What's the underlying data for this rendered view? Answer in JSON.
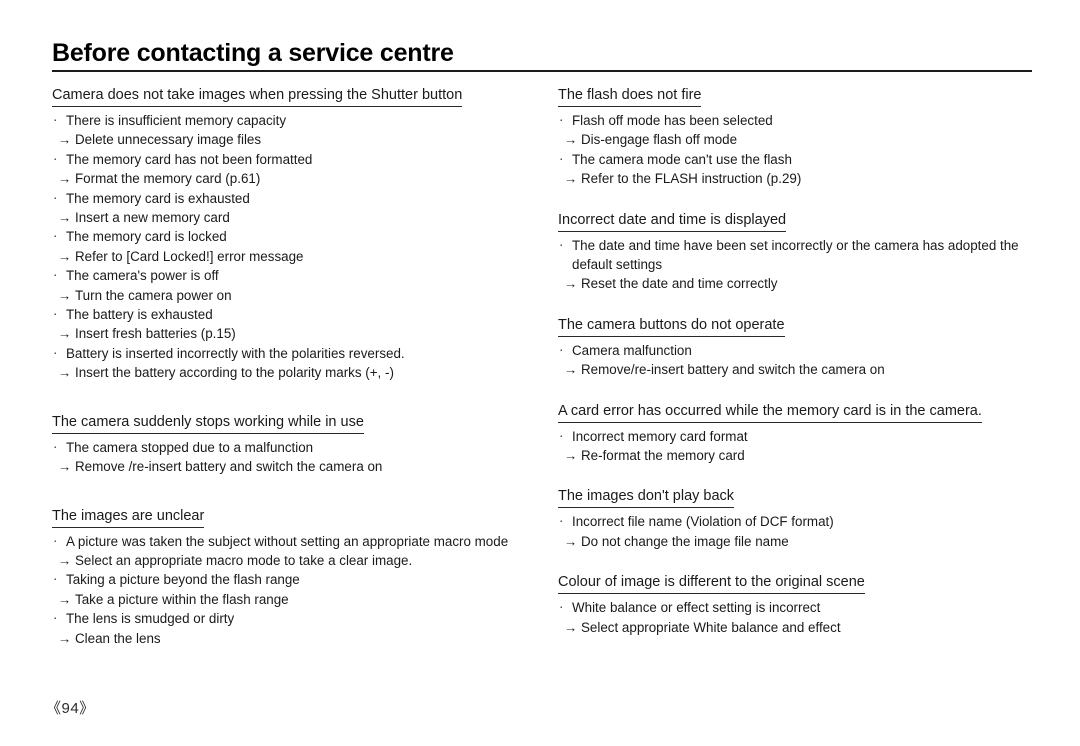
{
  "header": {
    "title": "Before contacting a service centre"
  },
  "footer": {
    "page_number": "《94》"
  },
  "glyphs": {
    "bullet": "·",
    "arrow": "→"
  },
  "columns": {
    "left": [
      {
        "heading": "Camera does not take images when pressing the Shutter button",
        "entries": [
          {
            "cause": "There is insufficient memory capacity",
            "remedy": "Delete unnecessary image files"
          },
          {
            "cause": "The memory card has not been formatted",
            "remedy": "Format the memory card (p.61)"
          },
          {
            "cause": "The memory card is exhausted",
            "remedy": "Insert a new memory card"
          },
          {
            "cause": "The memory card is locked",
            "remedy": "Refer to [Card Locked!] error message"
          },
          {
            "cause": "The camera's power is off",
            "remedy": "Turn the camera power on"
          },
          {
            "cause": "The battery is exhausted",
            "remedy": "Insert fresh batteries (p.15)"
          },
          {
            "cause": "Battery is inserted incorrectly with the polarities reversed.",
            "remedy": "Insert the battery according to the polarity marks (+, -)"
          }
        ]
      },
      {
        "heading": "The camera suddenly stops working while in use",
        "entries": [
          {
            "cause": "The camera stopped due to a malfunction",
            "remedy": "Remove /re-insert battery and switch the camera on"
          }
        ]
      },
      {
        "heading": "The images are unclear",
        "entries": [
          {
            "cause": "A picture was taken the subject without setting an appropriate macro mode",
            "remedy": "Select an appropriate macro mode to take a clear image."
          },
          {
            "cause": "Taking a picture beyond the flash range",
            "remedy": "Take a picture within the flash range"
          },
          {
            "cause": "The lens is smudged or dirty",
            "remedy": "Clean the lens"
          }
        ]
      }
    ],
    "right": [
      {
        "heading": "The flash does not fire",
        "entries": [
          {
            "cause": "Flash off mode has been selected",
            "remedy": "Dis-engage flash off mode"
          },
          {
            "cause": "The camera mode can't use the flash",
            "remedy": "Refer to the FLASH instruction (p.29)"
          }
        ]
      },
      {
        "heading": "Incorrect date and time is displayed",
        "entries": [
          {
            "cause": "The date and time have been set incorrectly or the camera has adopted the default settings",
            "remedy": "Reset the date and time correctly"
          }
        ]
      },
      {
        "heading": "The camera buttons do not operate",
        "entries": [
          {
            "cause": "Camera malfunction",
            "remedy": "Remove/re-insert battery and switch the camera on"
          }
        ]
      },
      {
        "heading": "A card error has occurred while the memory card is in the camera.",
        "entries": [
          {
            "cause": "Incorrect memory card format",
            "remedy": "Re-format the memory card"
          }
        ]
      },
      {
        "heading": "The images don't play back",
        "entries": [
          {
            "cause": "Incorrect file name (Violation of DCF format)",
            "remedy": "Do not change the image file name"
          }
        ]
      },
      {
        "heading": "Colour of image is different to the original scene",
        "entries": [
          {
            "cause": "White balance or effect setting is incorrect",
            "remedy": "Select appropriate White balance and effect"
          }
        ]
      }
    ]
  }
}
